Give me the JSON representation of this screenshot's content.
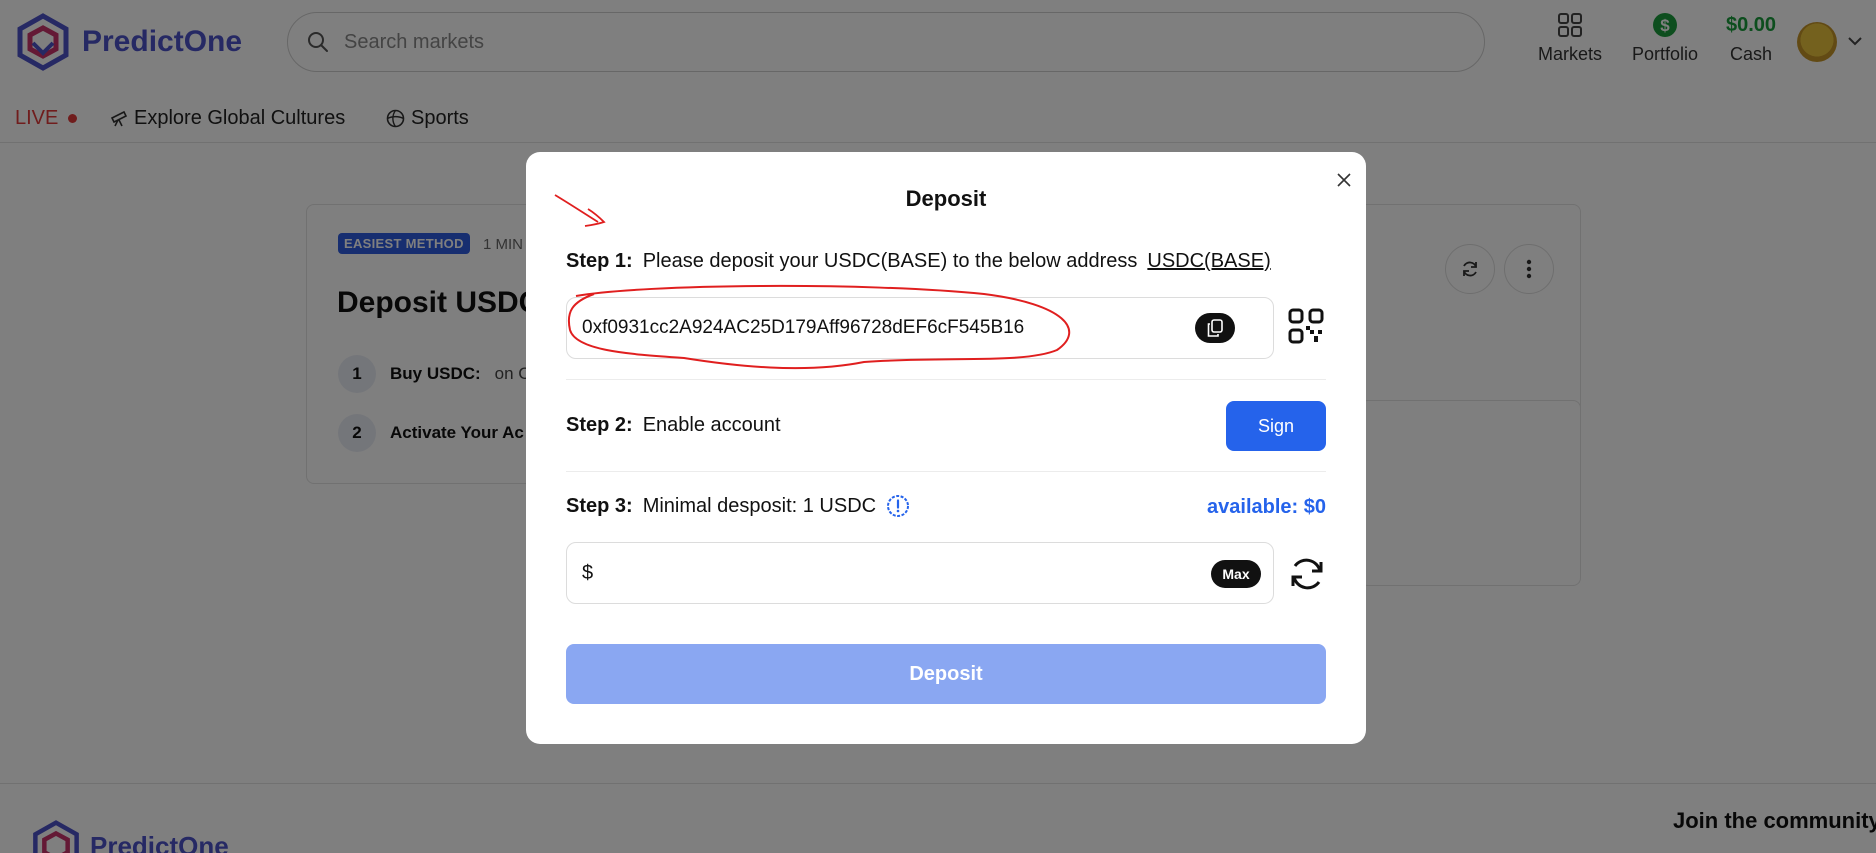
{
  "app": {
    "name": "PredictOne"
  },
  "header": {
    "search_placeholder": "Search markets",
    "nav": {
      "markets": "Markets",
      "portfolio": "Portfolio",
      "cash_value": "$0.00",
      "cash_label": "Cash"
    }
  },
  "subnav": {
    "live": "LIVE",
    "explore": "Explore Global Cultures",
    "sports": "Sports"
  },
  "background": {
    "badge": "EASIEST METHOD",
    "mins": "1 MIN",
    "title": "Deposit USDC",
    "steps": [
      {
        "num": "1",
        "label": "Buy USDC:",
        "text": "on C"
      },
      {
        "num": "2",
        "label": "Activate Your Ac",
        "text": ""
      }
    ]
  },
  "footer": {
    "logo": "PredictOne",
    "join": "Join the community"
  },
  "modal": {
    "title": "Deposit",
    "step1": {
      "label": "Step 1:",
      "text": "Please deposit your USDC(BASE) to the below address",
      "link": "USDC(BASE)",
      "address": "0xf0931cc2A924AC25D179Aff96728dEF6cF545B16"
    },
    "step2": {
      "label": "Step 2:",
      "text": "Enable account",
      "button": "Sign"
    },
    "step3": {
      "label": "Step 3:",
      "text": "Minimal desposit: 1 USDC",
      "available": "available: $0",
      "currency": "$",
      "amount_value": "",
      "max": "Max"
    },
    "deposit_button": "Deposit"
  },
  "colors": {
    "brand": "#4c52c9",
    "primary": "#2563eb",
    "cash": "#1a9c3c",
    "live": "#e03a3a",
    "deposit_disabled": "#8aa7f2",
    "annotation": "#e01f1f"
  }
}
